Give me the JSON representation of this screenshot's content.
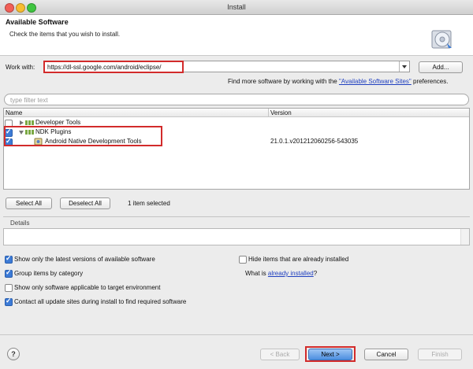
{
  "window": {
    "title": "Install"
  },
  "header": {
    "title": "Available Software",
    "subtitle": "Check the items that you wish to install."
  },
  "work_with": {
    "label": "Work with:",
    "value": "https://dl-ssl.google.com/android/eclipse/",
    "add_label": "Add...",
    "find_more_prefix": "Find more software by working with the ",
    "find_more_link": "\"Available Software Sites\"",
    "find_more_suffix": " preferences."
  },
  "filter": {
    "placeholder": "type filter text"
  },
  "table": {
    "columns": [
      "Name",
      "Version"
    ],
    "rows": [
      {
        "name": "Developer Tools",
        "version": "",
        "checked": false,
        "expanded": false,
        "icon": "package-group-icon"
      },
      {
        "name": "NDK Plugins",
        "version": "",
        "checked": true,
        "expanded": true,
        "icon": "package-group-icon"
      },
      {
        "name": "Android Native Development Tools",
        "version": "21.0.1.v201212060256-543035",
        "checked": true,
        "icon": "plugin-feature-icon"
      }
    ]
  },
  "selection": {
    "select_all": "Select All",
    "deselect_all": "Deselect All",
    "status": "1 item selected"
  },
  "details": {
    "label": "Details"
  },
  "options": {
    "latest_versions": {
      "label": "Show only the latest versions of available software",
      "checked": true
    },
    "group_by_category": {
      "label": "Group items by category",
      "checked": true
    },
    "target_env": {
      "label": "Show only software applicable to target environment",
      "checked": false
    },
    "contact_update_sites": {
      "label": "Contact all update sites during install to find required software",
      "checked": true
    },
    "hide_installed": {
      "label": "Hide items that are already installed",
      "checked": false
    },
    "what_is_prefix": "What is ",
    "what_is_link": "already installed",
    "what_is_suffix": "?"
  },
  "footer": {
    "help": "?",
    "back": "< Back",
    "next": "Next >",
    "cancel": "Cancel",
    "finish": "Finish"
  },
  "colors": {
    "highlight_red": "#d22b2b",
    "link_blue": "#1f3fbf",
    "check_blue": "#3d7bd6"
  }
}
